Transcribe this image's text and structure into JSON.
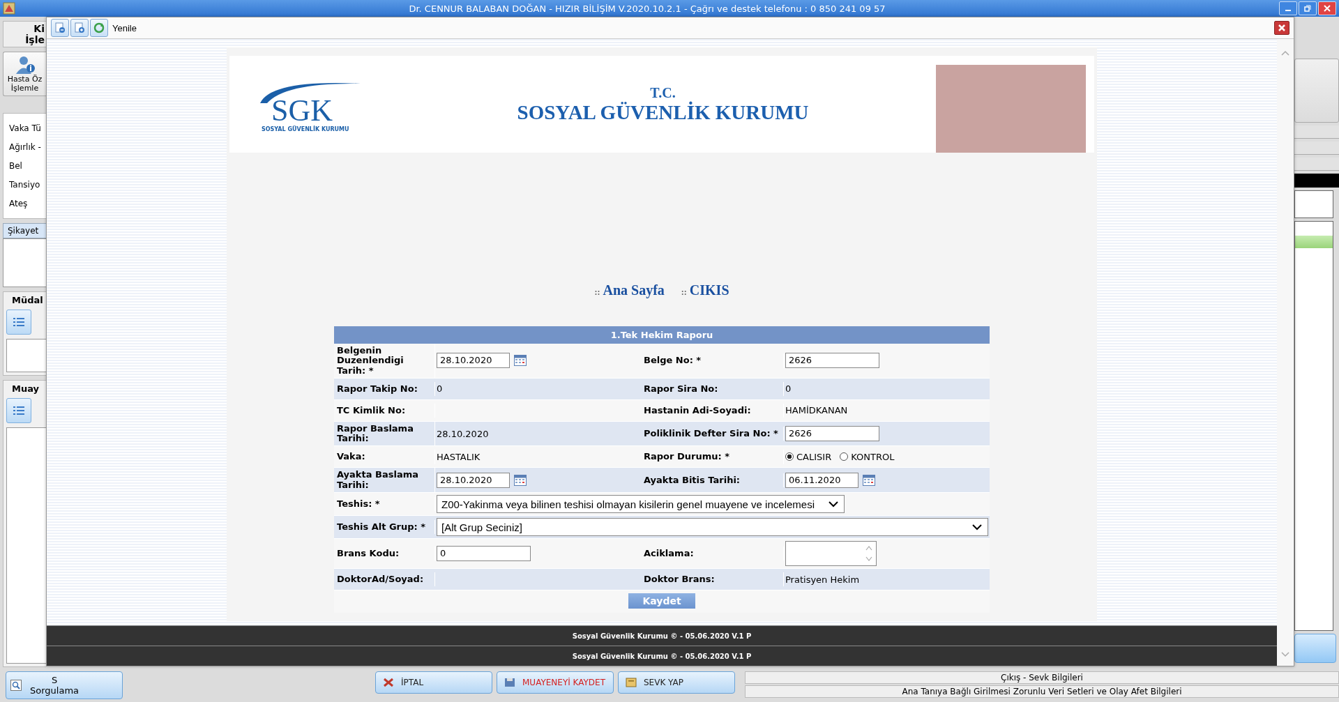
{
  "app": {
    "title": "Dr. CENNUR BALABAN DOĞAN - HIZIR BİLİŞİM V.2020.10.2.1 - Çağrı ve destek telefonu : 0 850 241 09 57"
  },
  "left_panel": {
    "header_lines": [
      "Ki",
      "İşle"
    ],
    "patient_button_lines": [
      "Hasta Öz",
      "İşlemle"
    ],
    "vitals": [
      "Vaka Tü",
      "Ağırlık -",
      "Bel",
      "Tansiyo",
      "Ateş"
    ],
    "complaint_tab": "Şikayet",
    "sections": [
      "Müdal",
      "Muay"
    ]
  },
  "bottom_bar": {
    "query_button_lines": [
      "S",
      "Sorgulama"
    ],
    "buttons": [
      {
        "label": "İPTAL",
        "kind": "cancel"
      },
      {
        "label": "MUAYENEYİ KAYDET",
        "kind": "save"
      },
      {
        "label": "SEVK YAP",
        "kind": "referral"
      }
    ],
    "links": [
      "Çıkış - Sevk Bilgileri",
      "Ana Tanıya Bağlı Girilmesi Zorunlu Veri Setleri ve Olay Afet Bilgileri"
    ]
  },
  "dialog": {
    "toolbar": {
      "label": "Yenile"
    },
    "header": {
      "logo_text": "SGK",
      "logo_subtext": "SOSYAL GÜVENLİK KURUMU",
      "prefix": "T.C.",
      "title": "SOSYAL GÜVENLİK KURUMU"
    },
    "nav": [
      {
        "separator": "::",
        "label": "Ana Sayfa"
      },
      {
        "separator": "::",
        "label": "CIKIS"
      }
    ],
    "form": {
      "title": "1.Tek Hekim Raporu",
      "submit": "Kaydet",
      "rows": [
        {
          "kind": "pair",
          "cells": [
            {
              "label": "Belgenin Duzenlendigi Tarih: *",
              "field": {
                "kind": "date",
                "value": "28.10.2020"
              }
            },
            {
              "label": "Belge No: *",
              "field": {
                "kind": "input",
                "value": "2626"
              }
            }
          ]
        },
        {
          "kind": "pair",
          "cells": [
            {
              "label": "Rapor Takip No:",
              "field": {
                "kind": "static",
                "value": "0"
              }
            },
            {
              "label": "Rapor Sira No:",
              "field": {
                "kind": "static",
                "value": "0"
              }
            }
          ]
        },
        {
          "kind": "pair",
          "cells": [
            {
              "label": "TC Kimlik No:",
              "field": {
                "kind": "static"
              }
            },
            {
              "label": "Hastanin Adi-Soyadi:",
              "field": {
                "kind": "static",
                "value": "HAMİDKANAN"
              }
            }
          ]
        },
        {
          "kind": "pair",
          "cells": [
            {
              "label": "Rapor Baslama Tarihi:",
              "field": {
                "kind": "static",
                "value": "28.10.2020"
              }
            },
            {
              "label": "Poliklinik Defter Sira No: *",
              "field": {
                "kind": "input",
                "value": "2626"
              }
            }
          ]
        },
        {
          "kind": "pair",
          "cells": [
            {
              "label": "Vaka:",
              "field": {
                "kind": "static",
                "value": "HASTALIK"
              }
            },
            {
              "label": "Rapor Durumu: *",
              "field": {
                "kind": "radio",
                "options": [
                  {
                    "label": "CALISIR",
                    "selected": true
                  },
                  {
                    "label": "KONTROL",
                    "selected": false
                  }
                ]
              }
            }
          ]
        },
        {
          "kind": "pair",
          "cells": [
            {
              "label": "Ayakta Baslama Tarihi:",
              "field": {
                "kind": "date",
                "value": "28.10.2020"
              }
            },
            {
              "label": "Ayakta Bitis Tarihi:",
              "field": {
                "kind": "date",
                "value": "06.11.2020"
              }
            }
          ]
        },
        {
          "kind": "wide",
          "cells": [
            {
              "label": "Teshis: *",
              "field": {
                "kind": "dropdown",
                "value": "Z00-Yakinma veya bilinen teshisi olmayan kisilerin genel muayene ve incelemesi"
              }
            }
          ]
        },
        {
          "kind": "wide",
          "cells": [
            {
              "label": "Teshis Alt Grup: *",
              "field": {
                "kind": "wide_dropdown",
                "value": "[Alt Grup Seciniz]"
              }
            }
          ]
        },
        {
          "kind": "pair",
          "cells": [
            {
              "label": "Brans Kodu:",
              "field": {
                "kind": "input",
                "value": "0"
              }
            },
            {
              "label": "Aciklama:",
              "field": {
                "kind": "textarea"
              }
            }
          ]
        },
        {
          "kind": "pair",
          "cells": [
            {
              "label": "DoktorAd/Soyad:",
              "field": {
                "kind": "static"
              }
            },
            {
              "label": "Doktor Brans:",
              "field": {
                "kind": "static",
                "value": "Pratisyen Hekim"
              }
            }
          ]
        }
      ]
    },
    "footers": [
      "Sosyal Güvenlik Kurumu © - 05.06.2020 V.1 P",
      "Sosyal Güvenlik Kurumu © - 05.06.2020 V.1 P"
    ]
  }
}
